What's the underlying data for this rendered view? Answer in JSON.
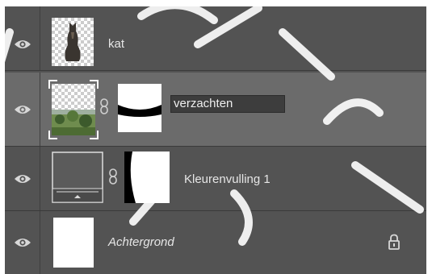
{
  "layers_panel": {
    "layers": [
      {
        "name": "kat",
        "italic": false,
        "visible": true,
        "selected": false,
        "thumbnail": "cat-cutout-on-transparency"
      },
      {
        "name": "verzachten",
        "italic": false,
        "visible": true,
        "selected": true,
        "renaming": true,
        "thumbnail": "forest-photo-on-transparency",
        "mask": "white-band-with-black-stripe"
      },
      {
        "name": "Kleurenvulling 1",
        "italic": false,
        "visible": true,
        "selected": false,
        "thumbnail": "solid-color-fill",
        "mask": "white-mask-with-black-edge"
      },
      {
        "name": "Achtergrond",
        "italic": true,
        "visible": true,
        "selected": false,
        "locked": true,
        "thumbnail": "white-background"
      }
    ]
  },
  "colors": {
    "panel_bg": "#535353",
    "selected_row_bg": "#6b6b6b",
    "text": "#e6e6e6",
    "divider": "#3a3a3a"
  },
  "icons": {
    "visibility": "eye-icon",
    "link": "chain-link-icon",
    "lock": "lock-icon"
  }
}
